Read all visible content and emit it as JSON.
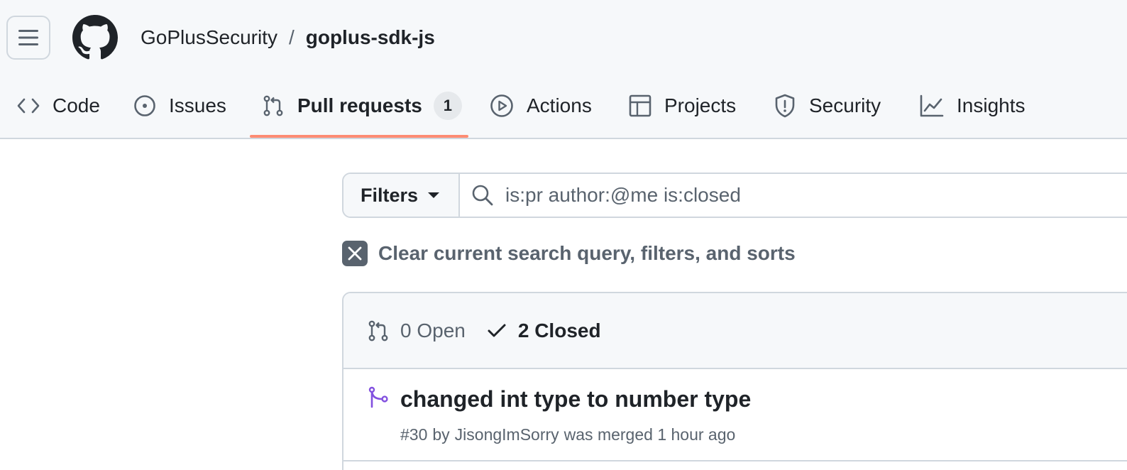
{
  "header": {
    "menu_icon": "hamburger-icon",
    "logo_icon": "github-octocat-icon",
    "repo_owner": "GoPlusSecurity",
    "separator": "/",
    "repo_name": "goplus-sdk-js"
  },
  "tabs": [
    {
      "label": "Code",
      "icon": "code-icon"
    },
    {
      "label": "Issues",
      "icon": "issue-opened-icon"
    },
    {
      "label": "Pull requests",
      "icon": "git-pull-request-icon",
      "count": "1",
      "active": true
    },
    {
      "label": "Actions",
      "icon": "play-icon"
    },
    {
      "label": "Projects",
      "icon": "table-icon"
    },
    {
      "label": "Security",
      "icon": "shield-icon"
    },
    {
      "label": "Insights",
      "icon": "graph-icon"
    }
  ],
  "filters": {
    "button_label": "Filters",
    "search_value": "is:pr author:@me is:closed",
    "search_icon": "search-icon"
  },
  "clear": {
    "label": "Clear current search query, filters, and sorts",
    "icon": "x-icon"
  },
  "states": {
    "open_label": "0 Open",
    "closed_label": "2 Closed"
  },
  "pull_requests": [
    {
      "title": "changed int type to number type",
      "number": "#30",
      "by": "by",
      "author": "JisongImSorry",
      "status": "was merged 1 hour ago",
      "icon": "git-merge-icon"
    }
  ],
  "colors": {
    "accent_underline": "#fd8c73",
    "merged_purple": "#8250df",
    "muted_text": "#59636e",
    "border": "#d0d7de"
  }
}
